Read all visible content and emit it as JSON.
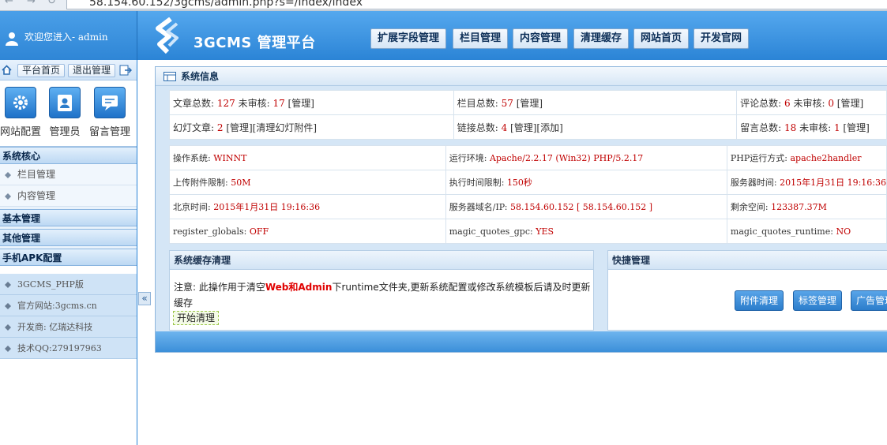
{
  "browser": {
    "url": "58.154.60.152/3gcms/admin.php?s=/Index/index",
    "back": "←",
    "forward": "→",
    "reload": "↻"
  },
  "header": {
    "welcome": "欢迎您进入- admin",
    "brand": "3GCMS 管理平台",
    "nav": [
      "扩展字段管理",
      "栏目管理",
      "内容管理",
      "清理缓存",
      "网站首页",
      "开发官网"
    ]
  },
  "sidebar": {
    "quick": {
      "home": "平台首页",
      "logout": "退出管理"
    },
    "tiles": [
      "网站配置",
      "管理员",
      "留言管理"
    ],
    "sections": [
      {
        "title": "系统核心",
        "items": [
          "栏目管理",
          "内容管理"
        ]
      },
      {
        "title": "基本管理",
        "items": []
      },
      {
        "title": "其他管理",
        "items": []
      },
      {
        "title": "手机APK配置",
        "items": []
      }
    ],
    "info": [
      "3GCMS_PHP版",
      "官方网站:3gcms.cn",
      "开发商: 亿瑞达科技",
      "技术QQ:279197963"
    ],
    "collapse": "«"
  },
  "main": {
    "title": "系统信息",
    "stats": {
      "r1c1": {
        "a": "文章总数: ",
        "v1": "127",
        "b": " 未审核: ",
        "v2": "17",
        "c": " [管理]"
      },
      "r1c2": {
        "a": "栏目总数: ",
        "v1": "57",
        "c": " [管理]"
      },
      "r1c3": {
        "a": "评论总数: ",
        "v1": "6",
        "b": " 未审核: ",
        "v2": "0",
        "c": " [管理]"
      },
      "r2c1": {
        "a": "幻灯文章: ",
        "v1": "2",
        "c": " [管理][清理幻灯附件]"
      },
      "r2c2": {
        "a": "链接总数: ",
        "v1": "4",
        "c": " [管理][添加]"
      },
      "r2c3": {
        "a": "留言总数: ",
        "v1": "18",
        "b": " 未审核: ",
        "v2": "1",
        "c": " [管理]"
      }
    },
    "env": [
      [
        {
          "k": "操作系统: ",
          "v": "WINNT"
        },
        {
          "k": "运行环境: ",
          "v": "Apache/2.2.17 (Win32) PHP/5.2.17"
        },
        {
          "k": "PHP运行方式: ",
          "v": "apache2handler"
        }
      ],
      [
        {
          "k": "上传附件限制: ",
          "v": "50M"
        },
        {
          "k": "执行时间限制: ",
          "v": "150秒"
        },
        {
          "k": "服务器时间: ",
          "v": "2015年1月31日 19:16:36"
        }
      ],
      [
        {
          "k": "北京时间: ",
          "v": "2015年1月31日 19:16:36"
        },
        {
          "k": "服务器域名/IP: ",
          "v": "58.154.60.152 [ 58.154.60.152 ]"
        },
        {
          "k": "剩余空间: ",
          "v": "123387.37M"
        }
      ],
      [
        {
          "k": "register_globals: ",
          "v": "OFF"
        },
        {
          "k": "magic_quotes_gpc: ",
          "v": "YES"
        },
        {
          "k": "magic_quotes_runtime: ",
          "v": "NO"
        }
      ]
    ],
    "cache": {
      "title": "系统缓存清理",
      "note_a": "注意: 此操作用于清空",
      "note_hl": "Web和Admin",
      "note_b": "下runtime文件夹,更新系统配置或修改系统模板后请及时更新缓存",
      "button": "开始清理"
    },
    "quickmgr": {
      "title": "快捷管理",
      "buttons": [
        "附件清理",
        "标签管理",
        "广告管理"
      ]
    }
  }
}
